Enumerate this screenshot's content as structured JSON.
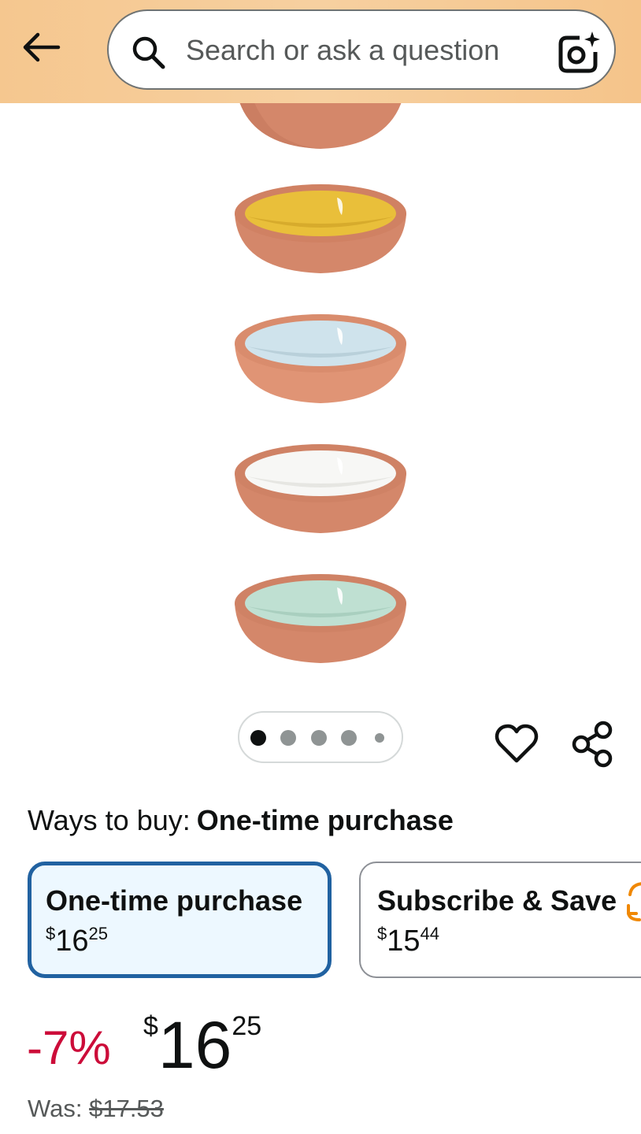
{
  "header": {
    "search_placeholder": "Search or ask a question",
    "back_icon": "arrow-left-icon",
    "search_icon": "magnifier-icon",
    "camera_icon": "camera-sparkle-icon",
    "background_color": "#f6c992"
  },
  "gallery": {
    "bowls": [
      {
        "color": "inside-partially-visible",
        "inner_hex": "#c87c5c"
      },
      {
        "color": "yellow",
        "inner_hex": "#e9bf3a"
      },
      {
        "color": "light-blue",
        "inner_hex": "#cfe3ec"
      },
      {
        "color": "white",
        "inner_hex": "#f7f7f5"
      },
      {
        "color": "mint",
        "inner_hex": "#bfe0d2"
      }
    ],
    "pager": {
      "total": 5,
      "active_index": 0
    },
    "actions": {
      "favorite_icon": "heart-outline-icon",
      "share_icon": "share-icon"
    }
  },
  "ways_to_buy": {
    "label": "Ways to buy:",
    "selected": "One-time purchase"
  },
  "options": [
    {
      "title": "One-time purchase",
      "symbol": "$",
      "whole": "16",
      "fraction": "25",
      "selected": true
    },
    {
      "title": "Subscribe & Save",
      "symbol": "$",
      "whole": "15",
      "fraction": "44",
      "selected": false,
      "icon": "subscribe-refresh-icon"
    }
  ],
  "price": {
    "discount": "-7%",
    "symbol": "$",
    "whole": "16",
    "fraction": "25",
    "was_label": "Was:",
    "was_price": "$17.53"
  },
  "colors": {
    "accent_blue": "#2162a1",
    "deal_red": "#cc0c39",
    "terracotta": "#d4876a"
  }
}
